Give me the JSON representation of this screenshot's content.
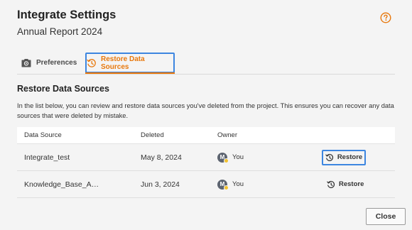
{
  "dialog": {
    "title": "Integrate Settings",
    "subtitle": "Annual Report 2024",
    "help_icon": "help-circle-icon",
    "accent_color": "#e8780c",
    "focus_color": "#3d86e0"
  },
  "tabs": [
    {
      "label": "Preferences",
      "icon": "preferences-icon",
      "active": false
    },
    {
      "label": "Restore Data Sources",
      "icon": "restore-history-icon",
      "active": true
    }
  ],
  "section": {
    "title": "Restore Data Sources",
    "description": "In the list below, you can review and restore data sources you've deleted from the project. This ensures you can recover any data sources that were deleted by mistake."
  },
  "table": {
    "columns": [
      "Data Source",
      "Deleted",
      "Owner"
    ],
    "rows": [
      {
        "name": "Integrate_test",
        "deleted": "May 8, 2024",
        "owner_initial": "M",
        "owner": "You",
        "action": "Restore"
      },
      {
        "name": "Knowledge_Base_A…",
        "deleted": "Jun 3, 2024",
        "owner_initial": "M",
        "owner": "You",
        "action": "Restore"
      }
    ]
  },
  "footer": {
    "close_label": "Close"
  }
}
